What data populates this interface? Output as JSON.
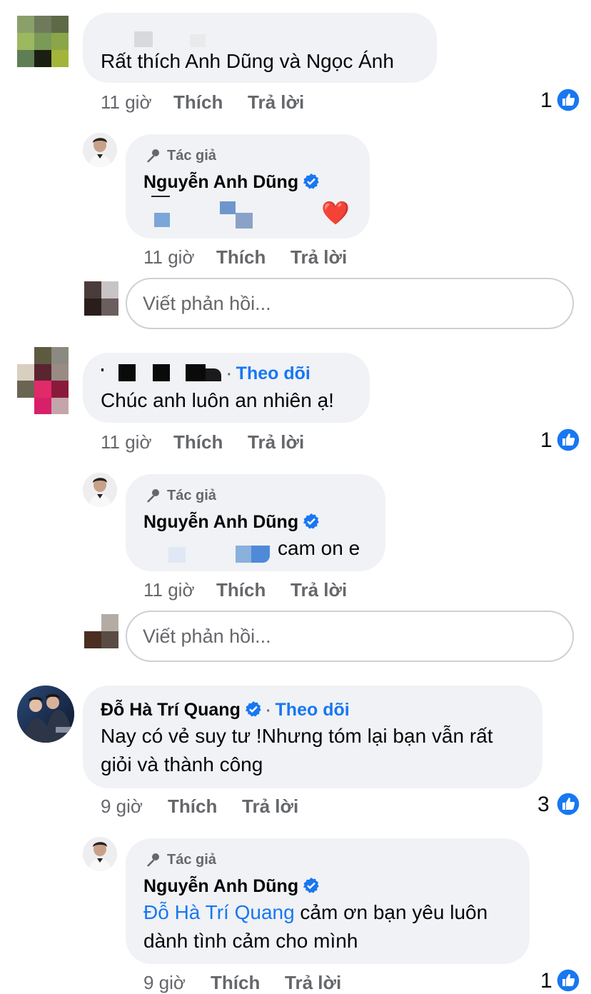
{
  "comments": [
    {
      "text": "Rất thích Anh Dũng và Ngọc Ánh",
      "time": "11 giờ",
      "like": "Thích",
      "reply": "Trả lời",
      "reactions": "1",
      "reply_item": {
        "author_badge": "Tác giả",
        "name": "Nguyễn Anh Dũng",
        "emoji": "❤️",
        "time": "11 giờ",
        "like": "Thích",
        "reply": "Trả lời"
      },
      "reply_placeholder": "Viết phản hồi..."
    },
    {
      "follow": "Theo dõi",
      "text": "Chúc anh luôn an nhiên ạ!",
      "time": "11 giờ",
      "like": "Thích",
      "reply": "Trả lời",
      "reactions": "1",
      "reply_item": {
        "author_badge": "Tác giả",
        "name": "Nguyễn Anh Dũng",
        "text": "cam on e",
        "time": "11 giờ",
        "like": "Thích",
        "reply": "Trả lời"
      },
      "reply_placeholder": "Viết phản hồi..."
    },
    {
      "name": "Đỗ Hà Trí Quang",
      "follow": "Theo dõi",
      "text_line1": "Nay có vẻ suy tư !Nhưng tóm lại bạn vẫn rất",
      "text_line2": "giỏi và thành công",
      "time": "9 giờ",
      "like": "Thích",
      "reply": "Trả lời",
      "reactions": "3",
      "reply_item": {
        "author_badge": "Tác giả",
        "name": "Nguyễn Anh Dũng",
        "mention": "Đỗ Hà Trí Quang",
        "text_line1": " cảm ơn bạn yêu luôn",
        "text_line2": "dành tình cảm cho mình",
        "time": "9 giờ",
        "like": "Thích",
        "reply": "Trả lời",
        "reactions": "1"
      }
    }
  ],
  "colors": {
    "bubble": "#f0f2f5",
    "secondary_text": "#65676b",
    "link": "#1877f2",
    "verified": "#1877f2"
  }
}
